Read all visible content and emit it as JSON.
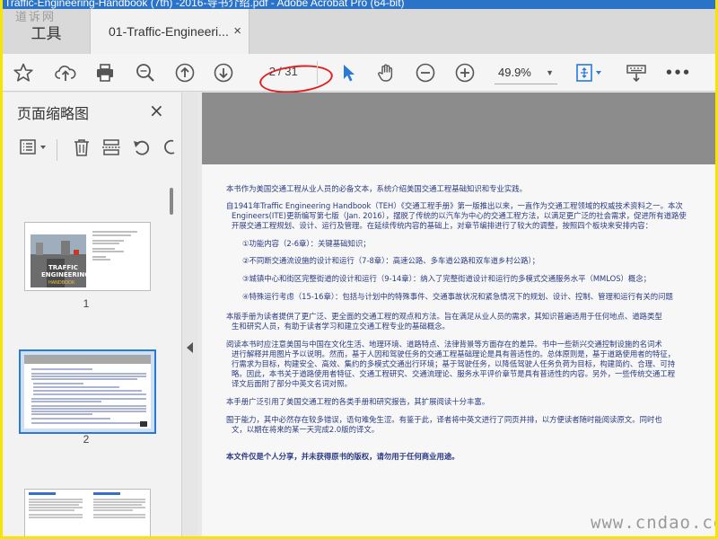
{
  "window": {
    "title": "Traffic-Engineering-Handbook (7th) -2016-导书介绍.pdf - Adobe Acrobat Pro (64-bit)"
  },
  "watermarks": {
    "top_left": "道诉网",
    "bottom_right": "www.cndao.com"
  },
  "tabs": {
    "tools_label": "工具",
    "document_label": "01-Traffic-Engineeri...",
    "close_glyph": "×"
  },
  "toolbar": {
    "icons": [
      "star-icon",
      "upload-icon",
      "print-icon",
      "zoom-search-icon",
      "page-up-icon",
      "page-down-icon",
      "select-pointer-icon",
      "hand-icon",
      "zoom-out-icon",
      "zoom-in-icon",
      "fit-page-icon",
      "keyboard-icon",
      "more-icon"
    ],
    "current_page": "2",
    "total_pages": "/ 31",
    "zoom_value": "49.9%",
    "caret": "▼",
    "more_label": "•••",
    "highlight_color": "#e02020",
    "accent_color": "#2a7ad5"
  },
  "panel": {
    "title": "页面缩略图",
    "close_glyph": "×",
    "thumbnails": [
      {
        "label": "1"
      },
      {
        "label": "2"
      }
    ],
    "thumb1_text": {
      "title1": "TRAFFIC",
      "title2": "ENGINEERING",
      "title3": "HANDBOOK"
    }
  },
  "document": {
    "paragraphs": [
      "本书作为美国交通工程从业人员的必备文本，系统介绍美国交通工程基础知识和专业实践。",
      "自1941年Traffic Engineering Handbook（TEH）《交通工程手册》第一版推出以来，一直作为交通工程领域的权威技术资料之一。本次",
      "Engineers(ITE)更新编写第七版（Jan. 2016），摆脱了传统的以汽车为中心的交通工程方法，以满足更广泛的社会需求，促进所有道路使",
      "开展交通工程规划、设计、运行及管理。在延续传统内容的基础上，对章节编排进行了较大的调整，按照四个板块来安排内容：",
      "①功能内容（2-6章）：关键基础知识；",
      "②不同断交通流设施的设计和运行（7-8章）：高速公路、多车道公路和双车道乡村公路）；",
      "③城镇中心和街区完整街道的设计和运行（9-14章）：纳入了完整街道设计和运行的多模式交通服务水平（MMLOS）概念；",
      "④特殊运行考虑（15-16章）：包括与计划中的特殊事件、交通事故状况和紧急情况下的规划、设计、控制、管理和运行有关的问题",
      "本版手册为读者提供了更广泛、更全面的交通工程的观点和方法。旨在满足从业人员的需求，其知识普遍适用于任何地点、道路类型",
      "生和研究人员，有助于读者学习和建立交通工程专业的基础概念。",
      "阅读本书时应注意美国与中国在文化生活、地理环境、道路特点、法律背景等方面存在的差异。书中一些新兴交通控制设施的名词术",
      "进行解释并用图片予以说明。然而，基于人因和驾驶任务的交通工程基础理论是具有普适性的。总体原则是，基于道路使用者的特征，",
      "行需求为目标，构建安全、高效、集约的多模式交通出行环境；基于驾驶任务，以降低驾驶人任务负荷为目标，构建简约、合理、可持",
      "略。因此，本书关于道路使用者特征、交通工程研究、交通流理论、服务水平评价章节是具有普适性的内容。另外，一些传统交通工程",
      "译文后面附了部分中英文名词对照。",
      "本手册广泛引用了美国交通工程的各类手册和研究报告，其扩展阅读十分丰富。",
      "囿于能力，其中必然存在较多错误，语句难免生涩。有鉴于此，译者将中英文进行了同页并排，以方便读者随时能阅读原文。同时也",
      "文，以期在将来的某一天完成2.0版的译文。",
      "本文件仅是个人分享，并未获得原书的版权，请勿用于任何商业用途。"
    ]
  }
}
